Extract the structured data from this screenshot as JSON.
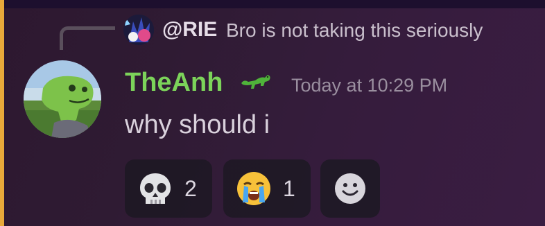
{
  "reply": {
    "author": "@RIE",
    "text": "Bro is not taking this seriously"
  },
  "message": {
    "author": "TheAnh",
    "author_color": "#7cd35a",
    "tag_icon": "dinosaur-icon",
    "timestamp": "Today at 10:29 PM",
    "text": "why should i"
  },
  "reactions": [
    {
      "emoji": "skull-emoji",
      "count": "2"
    },
    {
      "emoji": "loudly-crying-face-emoji",
      "count": "1"
    },
    {
      "emoji": "add-reaction-smiley-icon",
      "count": ""
    }
  ],
  "colors": {
    "accent_bar": "#e8a93a",
    "reaction_bg": "#1c1822"
  }
}
